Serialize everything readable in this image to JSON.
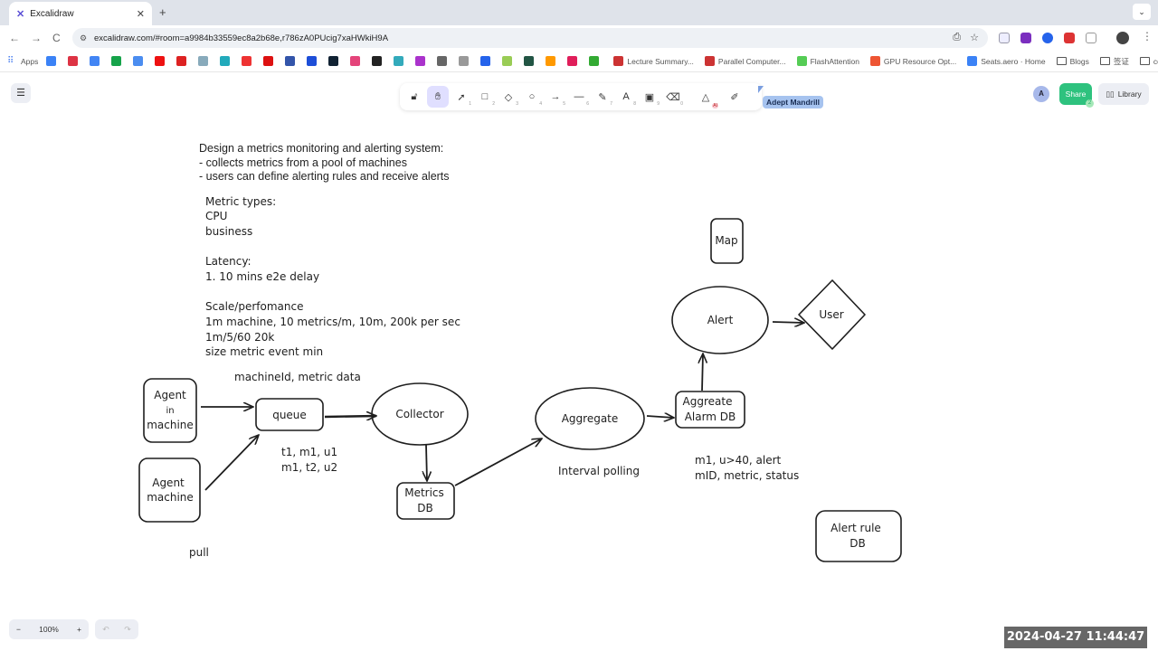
{
  "browser": {
    "tab_title": "Excalidraw",
    "new_tab": "+",
    "tab_menu": "⌄",
    "url": "excalidraw.com/#room=a9984b33559ec8a2b68e,r786zA0PUcig7xaHWkiH9A",
    "nav": {
      "back": "←",
      "forward": "→",
      "reload": "C"
    },
    "bookmarks": [
      {
        "label": "Apps",
        "color": "#888888"
      },
      {
        "label": "",
        "color": "#3b82f6"
      },
      {
        "label": "",
        "color": "#d34"
      },
      {
        "label": "",
        "color": "#4285f4"
      },
      {
        "label": "",
        "color": "#16a34a"
      },
      {
        "label": "",
        "color": "#4b8df0"
      },
      {
        "label": "",
        "color": "#e11"
      },
      {
        "label": "",
        "color": "#d22"
      },
      {
        "label": "",
        "color": "#8ab"
      },
      {
        "label": "",
        "color": "#2ab"
      },
      {
        "label": "",
        "color": "#e33"
      },
      {
        "label": "",
        "color": "#d11"
      },
      {
        "label": "",
        "color": "#3355aa"
      },
      {
        "label": "",
        "color": "#1d4ed8"
      },
      {
        "label": "",
        "color": "#123"
      },
      {
        "label": "",
        "color": "#e4447a"
      },
      {
        "label": "",
        "color": "#222"
      },
      {
        "label": "",
        "color": "#3ab"
      },
      {
        "label": "",
        "color": "#a3c"
      },
      {
        "label": "",
        "color": "#666"
      },
      {
        "label": "",
        "color": "#999"
      },
      {
        "label": "",
        "color": "#2563eb"
      },
      {
        "label": "",
        "color": "#9c5"
      },
      {
        "label": "",
        "color": "#254"
      },
      {
        "label": "",
        "color": "#f90"
      },
      {
        "label": "",
        "color": "#e01e5a"
      },
      {
        "label": "",
        "color": "#3a3"
      },
      {
        "label": "Lecture Summary...",
        "color": "#c33"
      },
      {
        "label": "Parallel Computer...",
        "color": "#c33"
      },
      {
        "label": "FlashAttention",
        "color": "#5c5"
      },
      {
        "label": "GPU Resource Opt...",
        "color": "#e53"
      },
      {
        "label": "Seats.aero · Home",
        "color": "#3b82f6"
      },
      {
        "label": "Blogs",
        "color": "folder"
      },
      {
        "label": "签证",
        "color": "folder"
      },
      {
        "label": "coin",
        "color": "folder"
      }
    ],
    "bookmarks_more": "»"
  },
  "app": {
    "menu_icon": "☰",
    "tools": [
      {
        "name": "lock",
        "glyph": "🔓︎",
        "key": ""
      },
      {
        "name": "hand",
        "glyph": "✋︎",
        "key": "",
        "active": true
      },
      {
        "name": "selection",
        "glyph": "➚",
        "key": "1"
      },
      {
        "name": "rectangle",
        "glyph": "□",
        "key": "2"
      },
      {
        "name": "diamond",
        "glyph": "◇",
        "key": "3"
      },
      {
        "name": "ellipse",
        "glyph": "○",
        "key": "4"
      },
      {
        "name": "arrow",
        "glyph": "→",
        "key": "5"
      },
      {
        "name": "line",
        "glyph": "—",
        "key": "6"
      },
      {
        "name": "draw",
        "glyph": "✎",
        "key": "7"
      },
      {
        "name": "text",
        "glyph": "A",
        "key": "8"
      },
      {
        "name": "image",
        "glyph": "▣",
        "key": "9"
      },
      {
        "name": "eraser",
        "glyph": "⌫",
        "key": "0"
      },
      {
        "name": "ai-tools",
        "glyph": "△",
        "key": "",
        "badge": "AI"
      },
      {
        "name": "laser",
        "glyph": "✐",
        "key": ""
      }
    ],
    "collaborator_label": "Adept Mandrill",
    "avatar_initial": "A",
    "share_label": "Share",
    "share_count": "2",
    "library_label": "Library",
    "zoom_out": "−",
    "zoom_level": "100%",
    "zoom_in": "+",
    "undo": "↶",
    "redo": "↷",
    "timestamp": "2024-04-27  11:44:47",
    "accent_color": "#2ec27e"
  },
  "canvas": {
    "prompt_lines": [
      "Design a metrics monitoring and alerting system:",
      "- collects metrics from a pool of machines",
      "- users can define alerting rules and receive alerts"
    ],
    "notes": [
      "Metric types:",
      "CPU",
      "business",
      "",
      "Latency:",
      "1. 10 mins e2e delay",
      "",
      "Scale/perfomance",
      "1m machine, 10 metrics/m, 10m, 200k per sec",
      "1m/5/60  20k",
      "size metric event min"
    ],
    "labels": {
      "machine_data": "machineId, metric data",
      "queue_data_1": "t1, m1, u1",
      "queue_data_2": "m1, t2, u2",
      "pull": "pull",
      "interval_polling": "Interval polling",
      "alarm_data_1": "m1, u>40, alert",
      "alarm_data_2": "mID, metric, status"
    },
    "nodes": {
      "agent_in_machine": [
        "Agent",
        "in",
        "machine"
      ],
      "agent_machine": [
        "Agent",
        "machine"
      ],
      "queue": "queue",
      "collector": "Collector",
      "metrics_db": [
        "Metrics",
        "DB"
      ],
      "aggregate": "Aggregate",
      "aggregate_alarm_db": [
        "Aggreate",
        "Alarm DB"
      ],
      "alert": "Alert",
      "user": "User",
      "map": "Map",
      "alert_rule_db": [
        "Alert rule",
        "DB"
      ]
    }
  }
}
